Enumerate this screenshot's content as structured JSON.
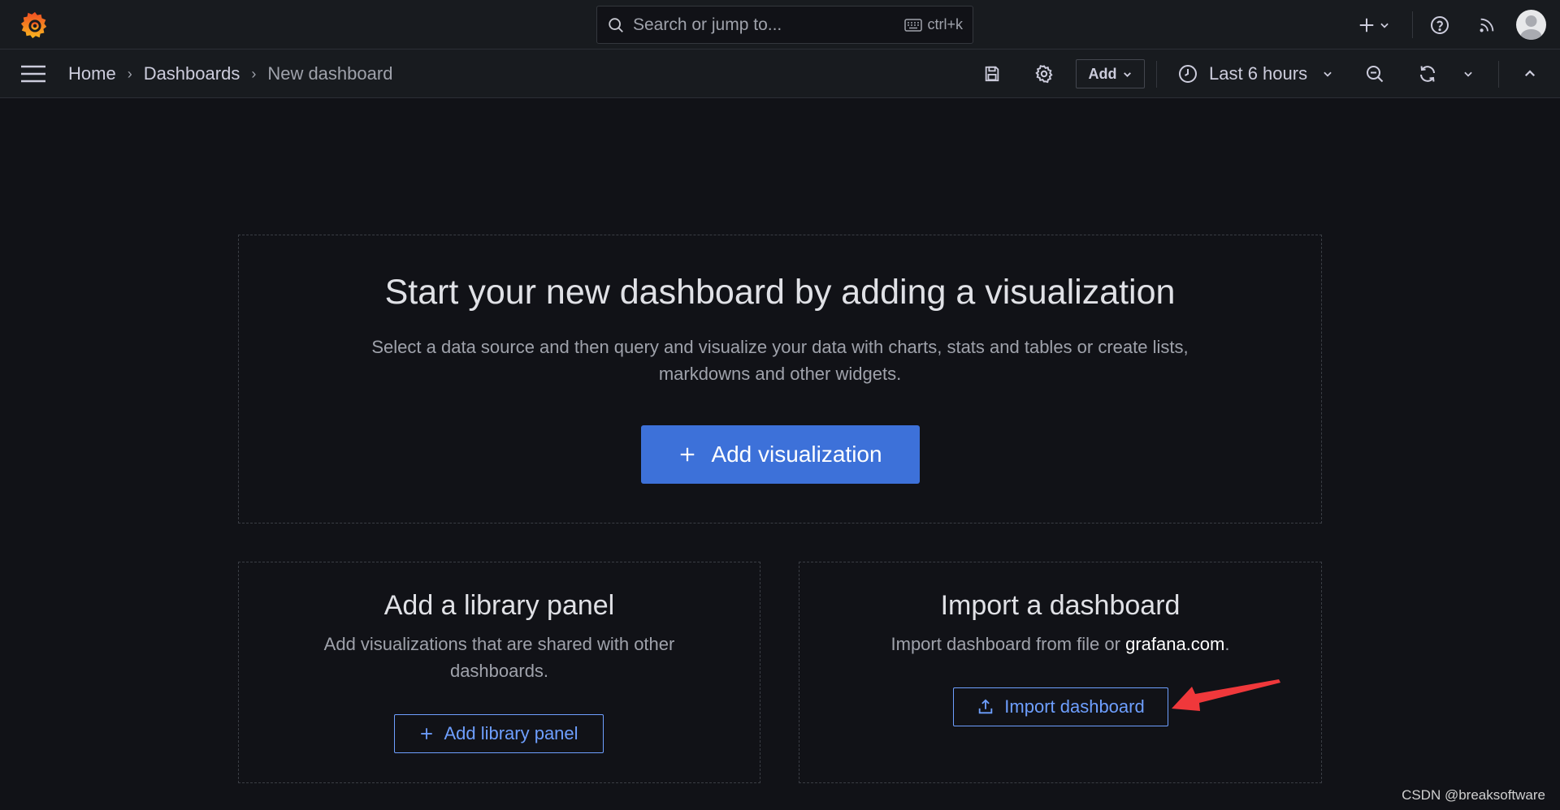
{
  "topbar": {
    "search_placeholder": "Search or jump to...",
    "search_shortcut": "ctrl+k"
  },
  "breadcrumb": {
    "home": "Home",
    "dashboards": "Dashboards",
    "current": "New dashboard"
  },
  "toolbar": {
    "add_label": "Add",
    "time_range": "Last 6 hours"
  },
  "main_panel": {
    "title": "Start your new dashboard by adding a visualization",
    "description_line1": "Select a data source and then query and visualize your data with charts, stats and tables or create lists,",
    "description_line2": "markdowns and other widgets.",
    "button_label": "Add visualization"
  },
  "library_panel": {
    "title": "Add a library panel",
    "description_line1": "Add visualizations that are shared with other",
    "description_line2": "dashboards.",
    "button_label": "Add library panel"
  },
  "import_panel": {
    "title": "Import a dashboard",
    "description_prefix": "Import dashboard from file or ",
    "description_link": "grafana.com",
    "description_suffix": ".",
    "button_label": "Import dashboard"
  },
  "watermark": "CSDN @breaksoftware",
  "colors": {
    "background": "#111217",
    "topbar": "#181b1f",
    "primary": "#3d71d9",
    "link_blue": "#6e9fff",
    "annotation_arrow": "#f0383b"
  },
  "icons": [
    "grafana-logo",
    "search-icon",
    "keyboard-icon",
    "plus-icon",
    "chevron-down-icon",
    "help-icon",
    "rss-icon",
    "avatar",
    "hamburger-menu-icon",
    "save-icon",
    "gear-icon",
    "clock-icon",
    "zoom-out-icon",
    "refresh-icon",
    "chevron-up-icon",
    "upload-icon"
  ]
}
